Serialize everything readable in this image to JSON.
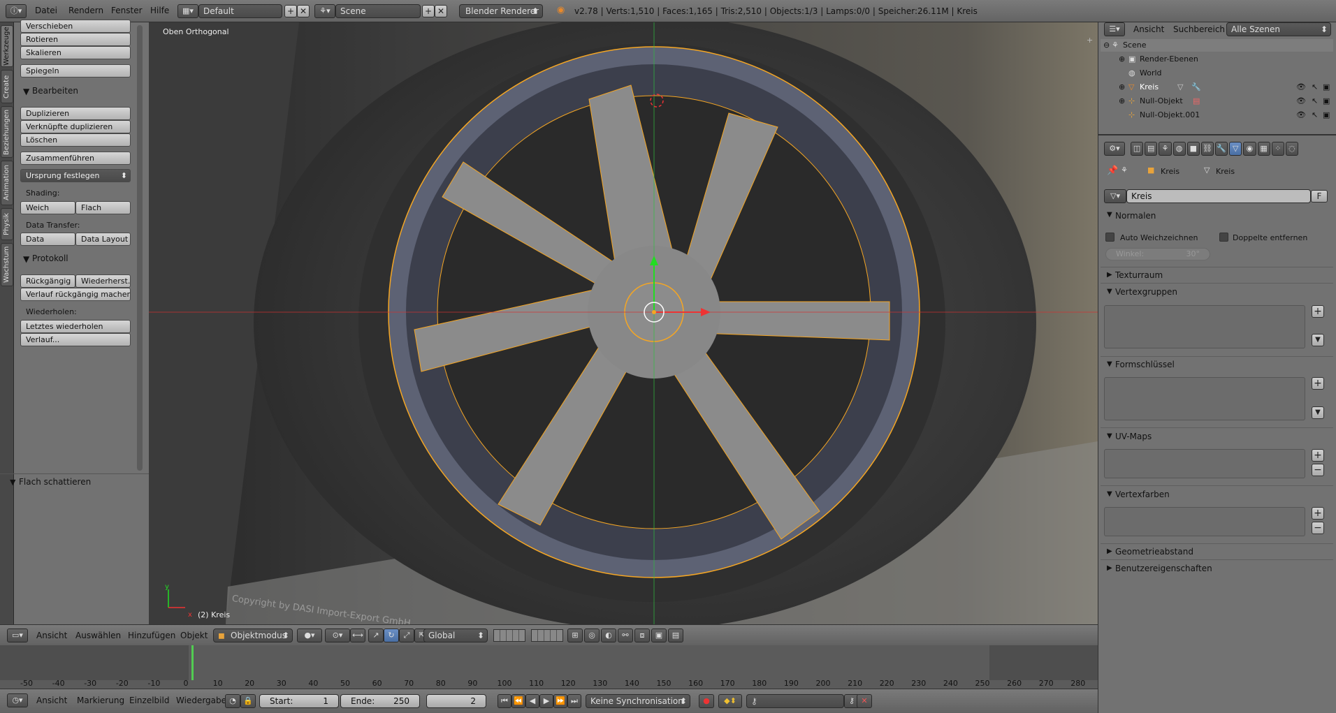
{
  "topbar": {
    "menus": [
      "Datei",
      "Rendern",
      "Fenster",
      "Hilfe"
    ],
    "screen_layout": "Default",
    "scene": "Scene",
    "render_engine": "Blender Renderer",
    "stats": "v2.78 | Verts:1,510 | Faces:1,165 | Tris:2,510 | Objects:1/3 | Lamps:0/0 | Speicher:26.11M | Kreis"
  },
  "toolshelf": {
    "tabs": [
      "Werkzeuge",
      "Create",
      "Beziehungen",
      "Animation",
      "Physik",
      "Wachstum"
    ],
    "transform_buttons": [
      "Verschieben",
      "Rotieren",
      "Skalieren"
    ],
    "mirror": "Spiegeln",
    "edit_header": "Bearbeiten",
    "edit_buttons": [
      "Duplizieren",
      "Verknüpfte duplizieren",
      "Löschen"
    ],
    "join": "Zusammenführen",
    "set_origin": "Ursprung festlegen",
    "shading_label": "Shading:",
    "shading_smooth": "Weich",
    "shading_flat": "Flach",
    "data_transfer_label": "Data Transfer:",
    "data_button": "Data",
    "data_layout_button": "Data Layout",
    "history_header": "Protokoll",
    "undo": "Rückgängig",
    "redo": "Wiederherst...",
    "undo_history": "Verlauf rückgängig machen",
    "repeat_label": "Wiederholen:",
    "repeat_last": "Letztes wiederholen",
    "repeat_history": "Verlauf...",
    "operator_panel": "Flach schattieren"
  },
  "viewport": {
    "view_name": "Oben Orthogonal",
    "object_info": "(2) Kreis",
    "watermark": "Copyright by DASI Import-Export GmbH",
    "axis_x": "x",
    "axis_y": "y"
  },
  "viewport_header": {
    "menus": [
      "Ansicht",
      "Auswählen",
      "Hinzufügen",
      "Objekt"
    ],
    "mode": "Objektmodus",
    "orientation": "Global"
  },
  "timeline": {
    "ticks": [
      "-50",
      "-40",
      "-30",
      "-20",
      "-10",
      "0",
      "10",
      "20",
      "30",
      "40",
      "50",
      "60",
      "70",
      "80",
      "90",
      "100",
      "110",
      "120",
      "130",
      "140",
      "150",
      "160",
      "170",
      "180",
      "190",
      "200",
      "210",
      "220",
      "230",
      "240",
      "250",
      "260",
      "270",
      "280"
    ],
    "current_frame": 2,
    "menus": [
      "Ansicht",
      "Markierung",
      "Einzelbild",
      "Wiedergabe"
    ],
    "start_label": "Start:",
    "start_value": "1",
    "end_label": "Ende:",
    "end_value": "250",
    "frame_value": "2",
    "sync": "Keine Synchronisation"
  },
  "outliner": {
    "menus": [
      "Ansicht",
      "Suchbereich"
    ],
    "filter": "Alle Szenen",
    "items": [
      {
        "label": "Scene",
        "icon": "scene-icon"
      },
      {
        "label": "Render-Ebenen",
        "icon": "render-layers-icon"
      },
      {
        "label": "World",
        "icon": "world-icon"
      },
      {
        "label": "Kreis",
        "icon": "mesh-object-icon"
      },
      {
        "label": "Null-Objekt",
        "icon": "empty-icon"
      },
      {
        "label": "Null-Objekt.001",
        "icon": "empty-icon"
      }
    ]
  },
  "properties": {
    "breadcrumb_object": "Kreis",
    "breadcrumb_mesh": "Kreis",
    "mesh_name": "Kreis",
    "fake_user": "F",
    "normals_header": "Normalen",
    "auto_smooth": "Auto Weichzeichnen",
    "double_sided": "Doppelte entfernen",
    "angle_label": "Winkel:",
    "angle_value": "30°",
    "texture_space": "Texturraum",
    "vertex_groups": "Vertexgruppen",
    "shape_keys": "Formschlüssel",
    "uv_maps": "UV-Maps",
    "vertex_colors": "Vertexfarben",
    "geometry_data": "Geometrieabstand",
    "custom_props": "Benutzereigenschaften"
  },
  "colors": {
    "selection": "#f5a623",
    "x_axis": "#d33030",
    "y_axis": "#2fbf3f",
    "current_frame": "#52cc52"
  }
}
